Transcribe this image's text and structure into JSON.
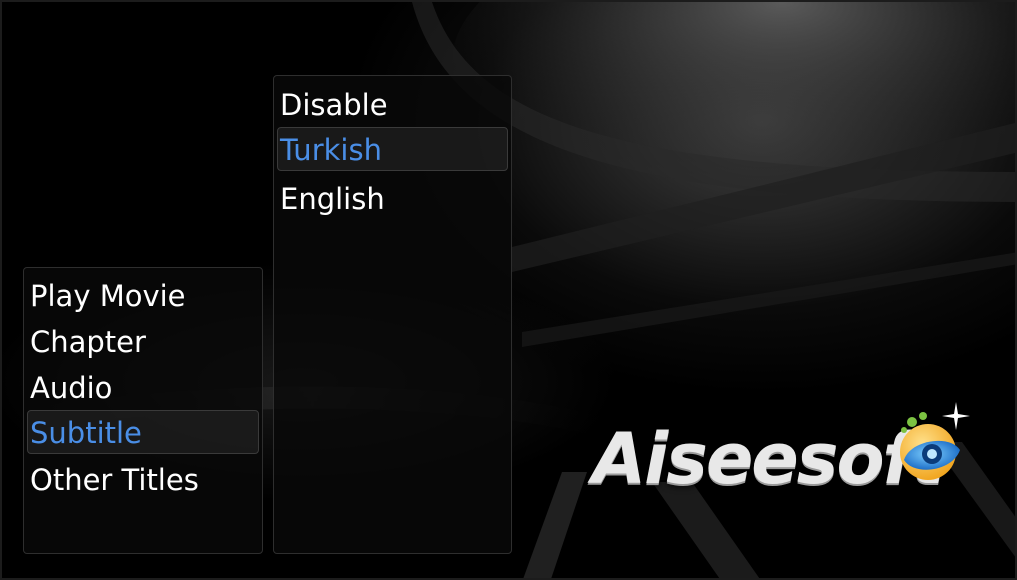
{
  "main_menu": {
    "items": [
      {
        "label": "Play Movie",
        "selected": false
      },
      {
        "label": "Chapter",
        "selected": false
      },
      {
        "label": "Audio",
        "selected": false
      },
      {
        "label": "Subtitle",
        "selected": true
      },
      {
        "label": "Other Titles",
        "selected": false
      }
    ]
  },
  "subtitle_menu": {
    "items": [
      {
        "label": "Disable",
        "selected": false
      },
      {
        "label": "Turkish",
        "selected": true
      },
      {
        "label": "English",
        "selected": false
      }
    ]
  },
  "logo": {
    "text": "Aiseesoft",
    "icon": "aiseesoft-eye-logo"
  },
  "colors": {
    "selected_text": "#4a8ee6",
    "normal_text": "#ffffff",
    "background": "#000000"
  }
}
